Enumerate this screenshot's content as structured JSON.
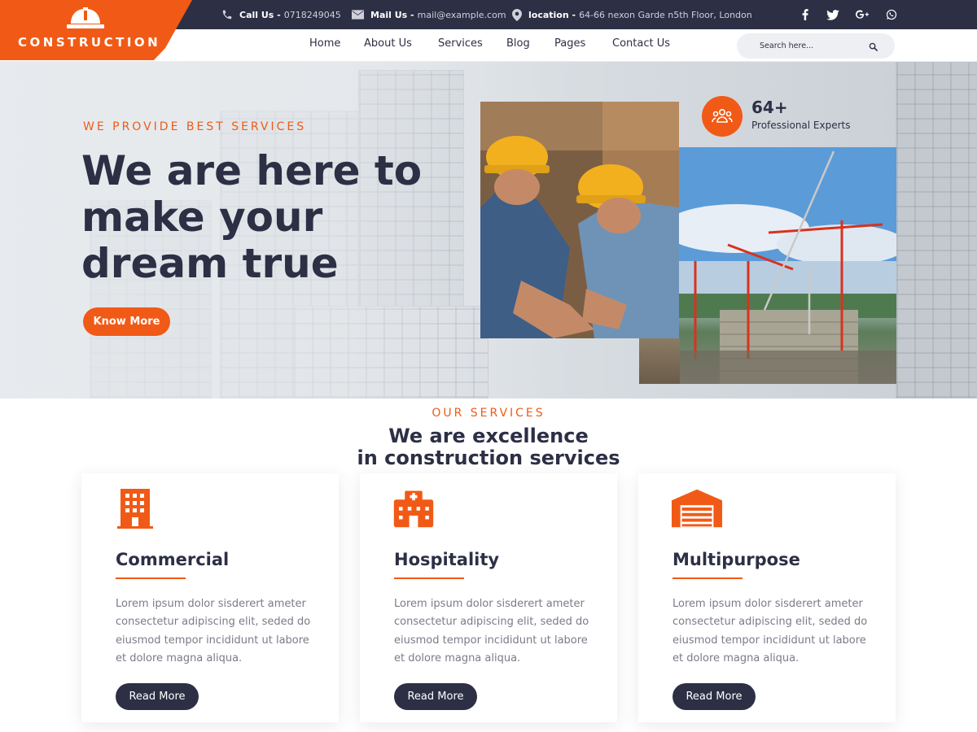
{
  "brand": {
    "name": "CONSTRUCTION"
  },
  "topbar": {
    "call_label": "Call Us -",
    "call_value": "0718249045",
    "mail_label": "Mail Us -",
    "mail_value": "mail@example.com",
    "location_label": "location -",
    "location_value": "64-66 nexon Garde n5th Floor, London",
    "social": [
      "facebook-icon",
      "twitter-icon",
      "google-plus-icon",
      "whatsapp-icon"
    ]
  },
  "nav": {
    "items": [
      "Home",
      "About Us",
      "Services",
      "Blog",
      "Pages",
      "Contact Us"
    ],
    "search_placeholder": "Search here..."
  },
  "hero": {
    "tagline": "WE PROVIDE BEST SERVICES",
    "title": "We are here to make your dream true",
    "button": "Know More",
    "experts_count": "64+",
    "experts_label": "Professional Experts"
  },
  "services": {
    "tagline": "OUR SERVICES",
    "title_line1": "We are excellence",
    "title_line2": "in construction services",
    "cards": [
      {
        "title": "Commercial",
        "icon": "building-icon",
        "text": "Lorem ipsum dolor sisderert ameter consectetur adipiscing elit, seded do eiusmod tempor incididunt ut labore et dolore magna aliqua.",
        "button": "Read More"
      },
      {
        "title": "Hospitality",
        "icon": "hospital-icon",
        "text": "Lorem ipsum dolor sisderert ameter consectetur adipiscing elit, seded do eiusmod tempor incididunt ut labore et dolore magna aliqua.",
        "button": "Read More"
      },
      {
        "title": "Multipurpose",
        "icon": "warehouse-icon",
        "text": "Lorem ipsum dolor sisderert ameter consectetur adipiscing elit, seded do eiusmod tempor incididunt ut labore et dolore magna aliqua.",
        "button": "Read More"
      }
    ]
  },
  "colors": {
    "accent": "#f15a16",
    "dark": "#2d2f45",
    "text_muted": "#7a7c88"
  }
}
